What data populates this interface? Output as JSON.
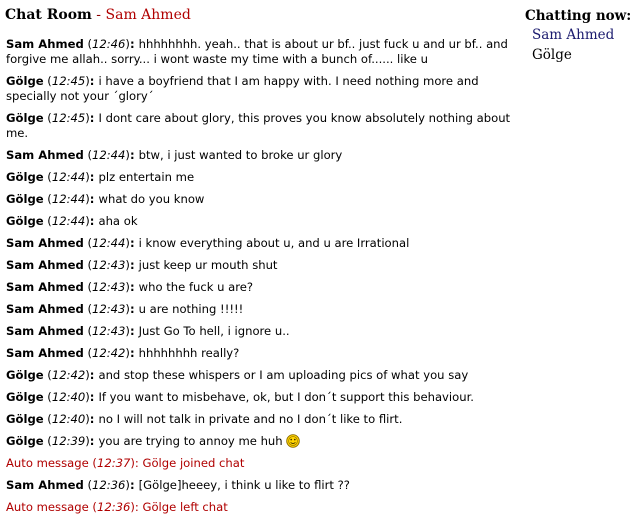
{
  "header": {
    "title": "Chat Room",
    "separator": " - ",
    "user": "Sam Ahmed"
  },
  "online": {
    "title": "Chatting now:",
    "users": [
      "Sam Ahmed",
      "Gölge"
    ]
  },
  "messages": [
    {
      "sender": "Sam Ahmed",
      "time": "12:46",
      "text": "hhhhhhhh. yeah.. that is about ur bf.. just fuck u and ur bf.. and forgive me allah.. sorry... i wont waste my time with a bunch of...... like u"
    },
    {
      "sender": "Gölge",
      "time": "12:45",
      "text": "i have a boyfriend that I am happy with. I need nothing more and specially not your ´glory´"
    },
    {
      "sender": "Gölge",
      "time": "12:45",
      "text": "I dont care about glory, this proves you know absolutely nothing about me."
    },
    {
      "sender": "Sam Ahmed",
      "time": "12:44",
      "text": "btw, i just wanted to broke ur glory"
    },
    {
      "sender": "Gölge",
      "time": "12:44",
      "text": "plz entertain me"
    },
    {
      "sender": "Gölge",
      "time": "12:44",
      "text": "what do you know"
    },
    {
      "sender": "Gölge",
      "time": "12:44",
      "text": "aha ok"
    },
    {
      "sender": "Sam Ahmed",
      "time": "12:44",
      "text": "i know everything about u, and u are Irrational"
    },
    {
      "sender": "Sam Ahmed",
      "time": "12:43",
      "text": "just keep ur mouth shut"
    },
    {
      "sender": "Sam Ahmed",
      "time": "12:43",
      "text": "who the fuck u are?"
    },
    {
      "sender": "Sam Ahmed",
      "time": "12:43",
      "text": "u are nothing !!!!!"
    },
    {
      "sender": "Sam Ahmed",
      "time": "12:43",
      "text": "Just Go To hell, i ignore u.."
    },
    {
      "sender": "Sam Ahmed",
      "time": "12:42",
      "text": "hhhhhhhh really?"
    },
    {
      "sender": "Gölge",
      "time": "12:42",
      "text": "and stop these whispers or I am uploading pics of what you say"
    },
    {
      "sender": "Gölge",
      "time": "12:40",
      "text": "If you want to misbehave, ok, but I don´t support this behaviour."
    },
    {
      "sender": "Gölge",
      "time": "12:40",
      "text": "no I will not talk in private and no I don´t like to flirt."
    },
    {
      "sender": "Gölge",
      "time": "12:39",
      "text": "you are trying to annoy me huh",
      "emoticon": "smiley-icon"
    },
    {
      "sender": "Auto message",
      "time": "12:37",
      "text": "Gölge joined chat",
      "auto": true
    },
    {
      "sender": "Sam Ahmed",
      "time": "12:36",
      "text": "[Gölge]heeey, i think u like to flirt ??"
    },
    {
      "sender": "Auto message",
      "time": "12:36",
      "text": "Gölge left chat",
      "auto": true
    }
  ]
}
